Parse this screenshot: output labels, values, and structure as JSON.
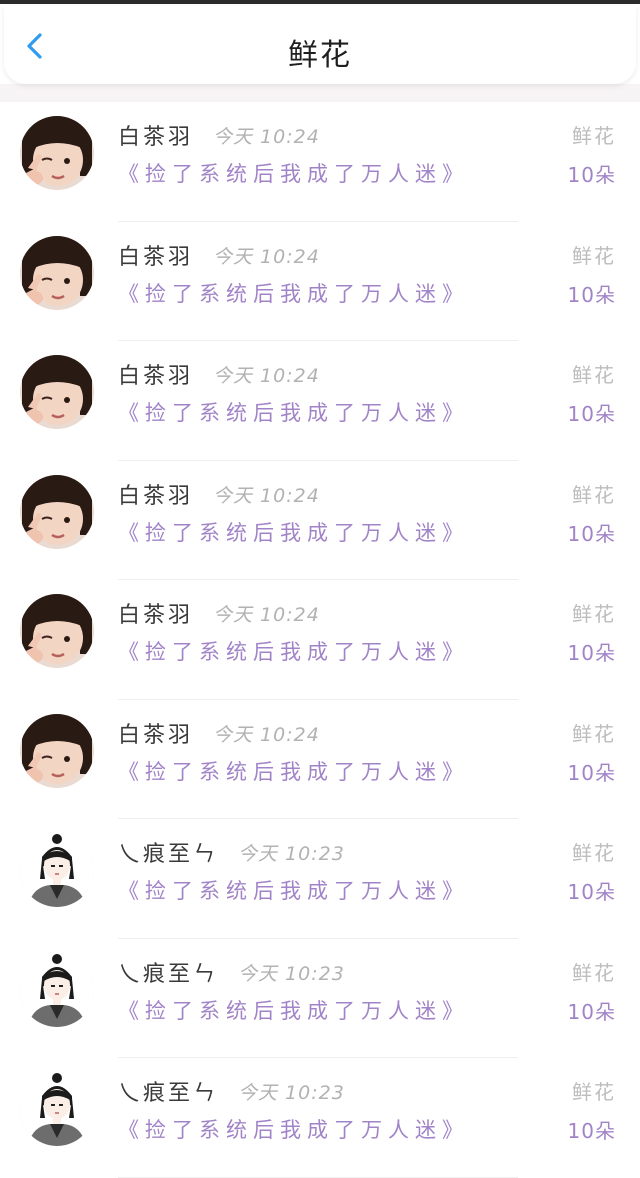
{
  "header": {
    "title": "鲜花",
    "back_icon": "chevron-left-icon"
  },
  "colors": {
    "accent_blue": "#2e9cf0",
    "book_purple": "#a184c8",
    "muted_gray": "#b2b2b2"
  },
  "gifts": [
    {
      "name": "白茶羽",
      "time": "今天 10:24",
      "book": "《捡了系统后我成了万人迷》",
      "gift_type": "鲜花",
      "gift_count": "10朵",
      "avatar": "toddler-photo"
    },
    {
      "name": "白茶羽",
      "time": "今天 10:24",
      "book": "《捡了系统后我成了万人迷》",
      "gift_type": "鲜花",
      "gift_count": "10朵",
      "avatar": "toddler-photo"
    },
    {
      "name": "白茶羽",
      "time": "今天 10:24",
      "book": "《捡了系统后我成了万人迷》",
      "gift_type": "鲜花",
      "gift_count": "10朵",
      "avatar": "toddler-photo"
    },
    {
      "name": "白茶羽",
      "time": "今天 10:24",
      "book": "《捡了系统后我成了万人迷》",
      "gift_type": "鲜花",
      "gift_count": "10朵",
      "avatar": "toddler-photo"
    },
    {
      "name": "白茶羽",
      "time": "今天 10:24",
      "book": "《捡了系统后我成了万人迷》",
      "gift_type": "鲜花",
      "gift_count": "10朵",
      "avatar": "toddler-photo"
    },
    {
      "name": "白茶羽",
      "time": "今天 10:24",
      "book": "《捡了系统后我成了万人迷》",
      "gift_type": "鲜花",
      "gift_count": "10朵",
      "avatar": "toddler-photo"
    },
    {
      "name": "乀痕至ㄣ",
      "time": "今天 10:23",
      "book": "《捡了系统后我成了万人迷》",
      "gift_type": "鲜花",
      "gift_count": "10朵",
      "avatar": "anime-character"
    },
    {
      "name": "乀痕至ㄣ",
      "time": "今天 10:23",
      "book": "《捡了系统后我成了万人迷》",
      "gift_type": "鲜花",
      "gift_count": "10朵",
      "avatar": "anime-character"
    },
    {
      "name": "乀痕至ㄣ",
      "time": "今天 10:23",
      "book": "《捡了系统后我成了万人迷》",
      "gift_type": "鲜花",
      "gift_count": "10朵",
      "avatar": "anime-character"
    }
  ]
}
